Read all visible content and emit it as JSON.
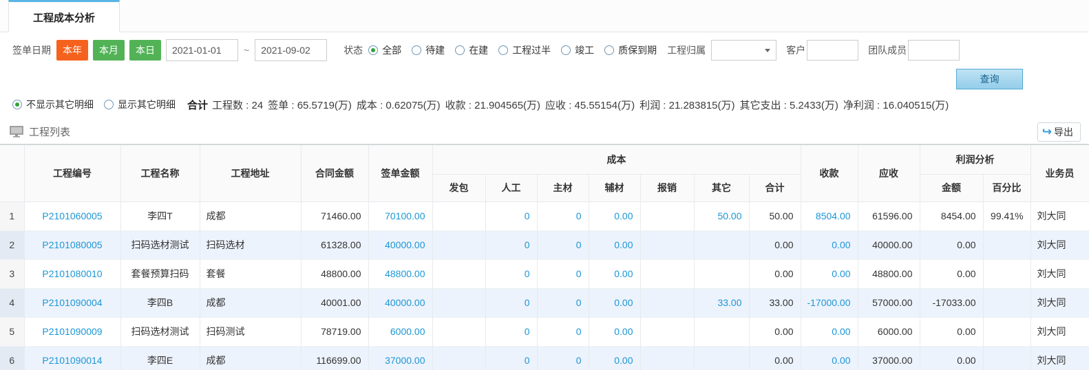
{
  "tab": {
    "title": "工程成本分析"
  },
  "filters": {
    "date_label": "签单日期",
    "quick_ranges": [
      {
        "label": "本年",
        "color": "#f5621d"
      },
      {
        "label": "本月",
        "color": "#52b356"
      },
      {
        "label": "本日",
        "color": "#52b356"
      }
    ],
    "date_from": "2021-01-01",
    "date_separator": "~",
    "date_to": "2021-09-02",
    "status_label": "状态",
    "status_options": [
      {
        "label": "全部",
        "selected": true
      },
      {
        "label": "待建",
        "selected": false
      },
      {
        "label": "在建",
        "selected": false
      },
      {
        "label": "工程过半",
        "selected": false
      },
      {
        "label": "竣工",
        "selected": false
      },
      {
        "label": "质保到期",
        "selected": false
      }
    ],
    "owner_label": "工程归属",
    "owner_value": "",
    "customer_label": "客户",
    "customer_value": "",
    "team_label": "团队成员",
    "team_value": "",
    "search_label": "查询"
  },
  "detail_toggle": [
    {
      "label": "不显示其它明细",
      "selected": true
    },
    {
      "label": "显示其它明细",
      "selected": false
    }
  ],
  "summary": {
    "prefix": "合计",
    "items": [
      "工程数 : 24",
      "签单 : 65.5719(万)",
      "成本 : 0.62075(万)",
      "收款 : 21.904565(万)",
      "应收 : 45.55154(万)",
      "利润 : 21.283815(万)",
      "其它支出 : 5.2433(万)",
      "净利润 : 16.040515(万)"
    ]
  },
  "list_bar": {
    "title": "工程列表",
    "export_label": "导出",
    "export_icon": "↪"
  },
  "table": {
    "header": {
      "code": "工程编号",
      "name": "工程名称",
      "address": "工程地址",
      "contract": "合同金额",
      "sign": "签单金额",
      "cost_group": "成本",
      "fabao": "发包",
      "rengong": "人工",
      "zhucai": "主材",
      "fucai": "辅材",
      "baoxiao": "报销",
      "qita": "其它",
      "heji": "合计",
      "shoukuan": "收款",
      "yingshou": "应收",
      "profit_group": "利润分析",
      "amount": "金额",
      "percent": "百分比",
      "sales": "业务员"
    },
    "rows": [
      {
        "num": "1",
        "code": "P2101060005",
        "name": "李四T",
        "address": "成都",
        "contract": "71460.00",
        "sign": "70100.00",
        "fabao": "",
        "rengong": "0",
        "zhucai": "0",
        "fucai": "0.00",
        "baoxiao": "",
        "qita": "50.00",
        "heji": "50.00",
        "shoukuan": "8504.00",
        "yingshou": "61596.00",
        "amount": "8454.00",
        "percent": "99.41%",
        "sales": "刘大同"
      },
      {
        "num": "2",
        "code": "P2101080005",
        "name": "扫码选材测试",
        "address": "扫码选材",
        "contract": "61328.00",
        "sign": "40000.00",
        "fabao": "",
        "rengong": "0",
        "zhucai": "0",
        "fucai": "0.00",
        "baoxiao": "",
        "qita": "",
        "heji": "0.00",
        "shoukuan": "0.00",
        "yingshou": "40000.00",
        "amount": "0.00",
        "percent": "",
        "sales": "刘大同"
      },
      {
        "num": "3",
        "code": "P2101080010",
        "name": "套餐预算扫码",
        "address": "套餐",
        "contract": "48800.00",
        "sign": "48800.00",
        "fabao": "",
        "rengong": "0",
        "zhucai": "0",
        "fucai": "0.00",
        "baoxiao": "",
        "qita": "",
        "heji": "0.00",
        "shoukuan": "0.00",
        "yingshou": "48800.00",
        "amount": "0.00",
        "percent": "",
        "sales": "刘大同"
      },
      {
        "num": "4",
        "code": "P2101090004",
        "name": "李四B",
        "address": "成都",
        "contract": "40001.00",
        "sign": "40000.00",
        "fabao": "",
        "rengong": "0",
        "zhucai": "0",
        "fucai": "0.00",
        "baoxiao": "",
        "qita": "33.00",
        "heji": "33.00",
        "shoukuan": "-17000.00",
        "yingshou": "57000.00",
        "amount": "-17033.00",
        "percent": "",
        "sales": "刘大同"
      },
      {
        "num": "5",
        "code": "P2101090009",
        "name": "扫码选材测试",
        "address": "扫码测试",
        "contract": "78719.00",
        "sign": "6000.00",
        "fabao": "",
        "rengong": "0",
        "zhucai": "0",
        "fucai": "0.00",
        "baoxiao": "",
        "qita": "",
        "heji": "0.00",
        "shoukuan": "0.00",
        "yingshou": "6000.00",
        "amount": "0.00",
        "percent": "",
        "sales": "刘大同"
      },
      {
        "num": "6",
        "code": "P2101090014",
        "name": "李四E",
        "address": "成都",
        "contract": "116699.00",
        "sign": "37000.00",
        "fabao": "",
        "rengong": "0",
        "zhucai": "0",
        "fucai": "0.00",
        "baoxiao": "",
        "qita": "",
        "heji": "0.00",
        "shoukuan": "0.00",
        "yingshou": "37000.00",
        "amount": "0.00",
        "percent": "",
        "sales": "刘大同"
      }
    ]
  }
}
